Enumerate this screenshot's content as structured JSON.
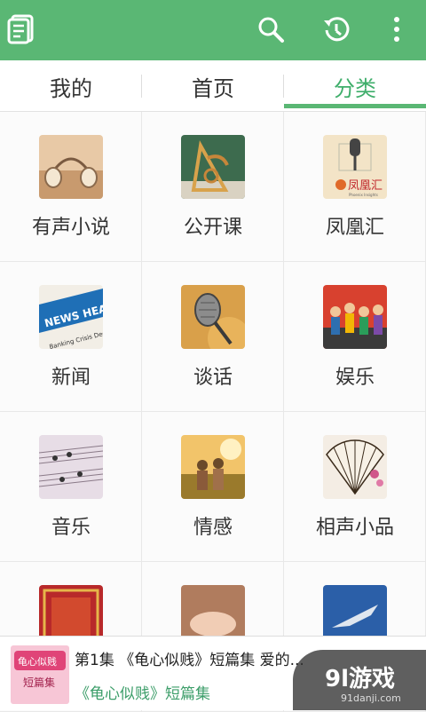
{
  "toolbar": {
    "icons": [
      "book-list-icon",
      "search-icon",
      "history-icon",
      "more-vert-icon"
    ],
    "accent": "#5ab774"
  },
  "tabs": [
    {
      "label": "我的"
    },
    {
      "label": "首页"
    },
    {
      "label": "分类"
    }
  ],
  "categories": [
    {
      "label": "有声小说"
    },
    {
      "label": "公开课"
    },
    {
      "label": "凤凰汇"
    },
    {
      "label": "新闻"
    },
    {
      "label": "谈话"
    },
    {
      "label": "娱乐"
    },
    {
      "label": "音乐"
    },
    {
      "label": "情感"
    },
    {
      "label": "相声小品"
    }
  ],
  "player": {
    "title": "第1集 《龟心似贱》短篇集 爱的...",
    "subtitle": "《龟心似贱》短篇集"
  },
  "watermark": {
    "main": "9l游戏",
    "sub": "91danji.com"
  }
}
